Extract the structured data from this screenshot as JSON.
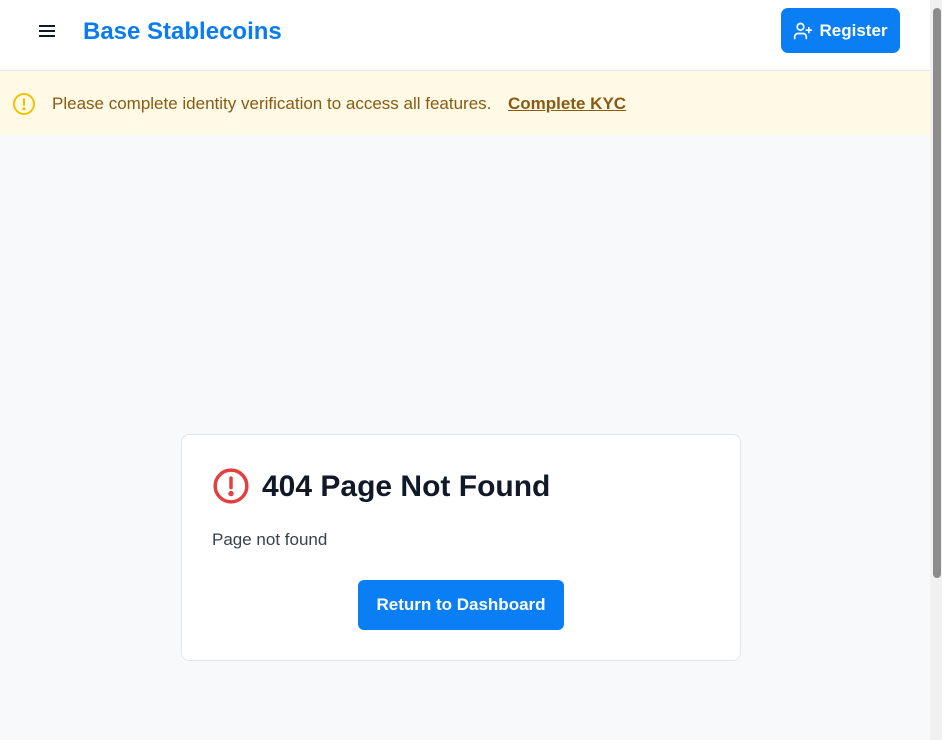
{
  "header": {
    "brand": "Base Stablecoins",
    "register_label": "Register",
    "menu_icon": "hamburger-icon",
    "register_icon": "user-plus-icon"
  },
  "banner": {
    "message": "Please complete identity verification to access all features.",
    "link_label": "Complete KYC",
    "icon": "warning-circle-icon",
    "colors": {
      "background": "#fefae6",
      "text": "#8a5a12",
      "icon": "#f2c200"
    }
  },
  "error_card": {
    "title": "404 Page Not Found",
    "message": "Page not found",
    "button_label": "Return to Dashboard",
    "icon": "error-circle-icon",
    "colors": {
      "icon": "#e53e3e",
      "button": "#0a7ff5"
    }
  },
  "colors": {
    "brand": "#0a7cf0",
    "page_background": "#f8f9fb"
  }
}
